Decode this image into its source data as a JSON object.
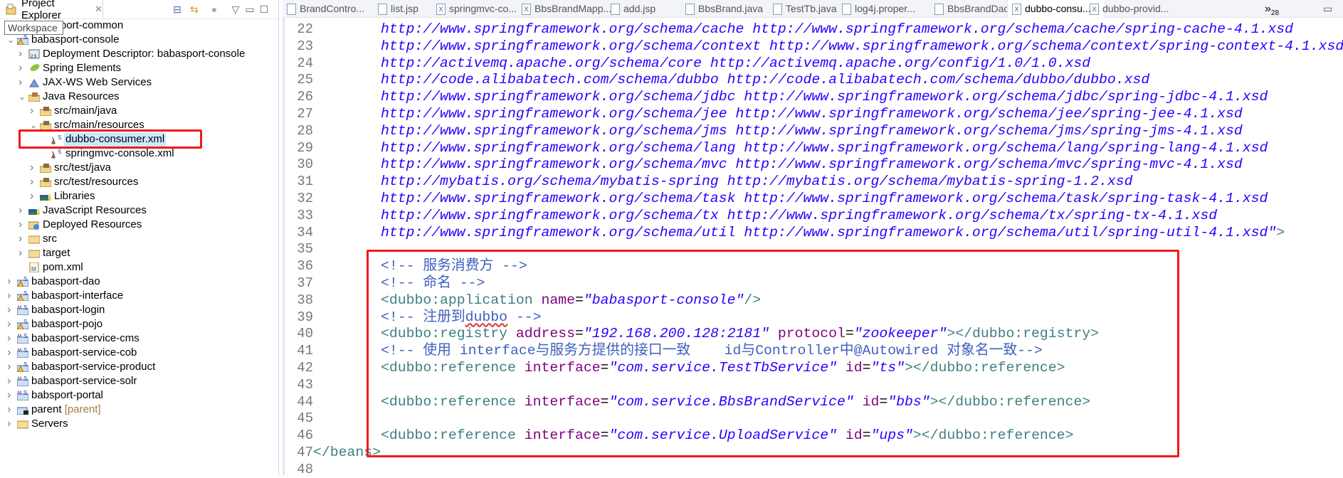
{
  "project_explorer": {
    "title": "Project Explorer",
    "tooltip": "Workspace",
    "tree": [
      {
        "label": "babasport-common",
        "level": 0,
        "expanded": false,
        "icon": "maven-project-icon"
      },
      {
        "label": "babasport-console",
        "level": 0,
        "expanded": true,
        "icon": "maven-project-warning-icon"
      },
      {
        "label": "Deployment Descriptor: babasport-console",
        "level": 1,
        "expanded": false,
        "icon": "deployment-descriptor-icon"
      },
      {
        "label": "Spring Elements",
        "level": 1,
        "expanded": false,
        "icon": "spring-leaf-icon"
      },
      {
        "label": "JAX-WS Web Services",
        "level": 1,
        "expanded": false,
        "icon": "web-services-icon"
      },
      {
        "label": "Java Resources",
        "level": 1,
        "expanded": true,
        "icon": "java-resources-icon"
      },
      {
        "label": "src/main/java",
        "level": 2,
        "expanded": false,
        "icon": "source-folder-icon"
      },
      {
        "label": "src/main/resources",
        "level": 2,
        "expanded": true,
        "icon": "source-folder-icon"
      },
      {
        "label": "dubbo-consumer.xml",
        "level": 3,
        "leaf": true,
        "selected": true,
        "icon": "spring-xml-file-icon"
      },
      {
        "label": "springmvc-console.xml",
        "level": 3,
        "leaf": true,
        "icon": "spring-xml-file-icon"
      },
      {
        "label": "src/test/java",
        "level": 2,
        "expanded": false,
        "icon": "source-folder-icon"
      },
      {
        "label": "src/test/resources",
        "level": 2,
        "expanded": false,
        "icon": "source-folder-icon"
      },
      {
        "label": "Libraries",
        "level": 2,
        "expanded": false,
        "icon": "libraries-icon"
      },
      {
        "label": "JavaScript Resources",
        "level": 1,
        "expanded": false,
        "icon": "libraries-icon"
      },
      {
        "label": "Deployed Resources",
        "level": 1,
        "expanded": false,
        "icon": "deployed-resources-icon"
      },
      {
        "label": "src",
        "level": 1,
        "expanded": false,
        "icon": "folder-icon"
      },
      {
        "label": "target",
        "level": 1,
        "expanded": false,
        "icon": "folder-icon"
      },
      {
        "label": "pom.xml",
        "level": 1,
        "leaf": true,
        "icon": "maven-pom-icon"
      },
      {
        "label": "babasport-dao",
        "level": 0,
        "expanded": false,
        "icon": "maven-project-warning-icon"
      },
      {
        "label": "babasport-interface",
        "level": 0,
        "expanded": false,
        "icon": "maven-project-warning-icon"
      },
      {
        "label": "babasport-login",
        "level": 0,
        "expanded": false,
        "icon": "maven-project-icon"
      },
      {
        "label": "babasport-pojo",
        "level": 0,
        "expanded": false,
        "icon": "maven-project-warning-icon"
      },
      {
        "label": "babasport-service-cms",
        "level": 0,
        "expanded": false,
        "icon": "maven-project-icon"
      },
      {
        "label": "babasport-service-cob",
        "level": 0,
        "expanded": false,
        "icon": "maven-project-icon"
      },
      {
        "label": "babasport-service-product",
        "level": 0,
        "expanded": false,
        "icon": "maven-project-warning-icon"
      },
      {
        "label": "babasport-service-solr",
        "level": 0,
        "expanded": false,
        "icon": "maven-project-icon"
      },
      {
        "label": "babsport-portal",
        "level": 0,
        "expanded": false,
        "icon": "maven-project-icon"
      },
      {
        "label": "parent",
        "decoration": "[parent]",
        "level": 0,
        "expanded": false,
        "icon": "maven-parent-icon"
      },
      {
        "label": "Servers",
        "level": 0,
        "expanded": false,
        "icon": "folder-icon"
      }
    ]
  },
  "editor_tabs": [
    {
      "label": "BrandContro...",
      "active": false
    },
    {
      "label": "list.jsp",
      "active": false
    },
    {
      "label": "springmvc-co...",
      "active": false
    },
    {
      "label": "BbsBrandMapp...",
      "active": false
    },
    {
      "label": "add.jsp",
      "active": false
    },
    {
      "label": "BbsBrand.java",
      "active": false
    },
    {
      "label": "TestTb.java",
      "active": false
    },
    {
      "label": "log4j.proper...",
      "active": false
    },
    {
      "label": "BbsBrandDao...",
      "active": false
    },
    {
      "label": "dubbo-consu...",
      "active": true
    },
    {
      "label": "dubbo-provid...",
      "active": false
    }
  ],
  "overflow_tabs": {
    "label": "»",
    "count": "28"
  },
  "colors": {
    "tag": "#3f7f7f",
    "attribute": "#7f007f",
    "value": "#2a00ff",
    "comment": "#3f5fbf",
    "highlight": "#f01a1a"
  },
  "code_lines": [
    {
      "n": "22",
      "tokens": [
        [
          "v",
          "        http://www.springframework.org/schema/cache http://www.springframework.org/schema/cache/spring-cache-4.1.xsd"
        ]
      ]
    },
    {
      "n": "23",
      "tokens": [
        [
          "v",
          "        http://www.springframework.org/schema/context http://www.springframework.org/schema/context/spring-context-4.1.xsd"
        ]
      ]
    },
    {
      "n": "24",
      "tokens": [
        [
          "v",
          "        http://activemq.apache.org/schema/core http://activemq.apache.org/config/1.0/1.0.xsd"
        ]
      ]
    },
    {
      "n": "25",
      "tokens": [
        [
          "v",
          "        http://code.alibabatech.com/schema/dubbo http://code.alibabatech.com/schema/dubbo/dubbo.xsd"
        ]
      ]
    },
    {
      "n": "26",
      "tokens": [
        [
          "v",
          "        http://www.springframework.org/schema/jdbc http://www.springframework.org/schema/jdbc/spring-jdbc-4.1.xsd"
        ]
      ]
    },
    {
      "n": "27",
      "tokens": [
        [
          "v",
          "        http://www.springframework.org/schema/jee http://www.springframework.org/schema/jee/spring-jee-4.1.xsd"
        ]
      ]
    },
    {
      "n": "28",
      "tokens": [
        [
          "v",
          "        http://www.springframework.org/schema/jms http://www.springframework.org/schema/jms/spring-jms-4.1.xsd"
        ]
      ]
    },
    {
      "n": "29",
      "tokens": [
        [
          "v",
          "        http://www.springframework.org/schema/lang http://www.springframework.org/schema/lang/spring-lang-4.1.xsd"
        ]
      ]
    },
    {
      "n": "30",
      "tokens": [
        [
          "v",
          "        http://www.springframework.org/schema/mvc http://www.springframework.org/schema/mvc/spring-mvc-4.1.xsd"
        ]
      ]
    },
    {
      "n": "31",
      "tokens": [
        [
          "v",
          "        http://mybatis.org/schema/mybatis-spring http://mybatis.org/schema/mybatis-spring-1.2.xsd"
        ]
      ]
    },
    {
      "n": "32",
      "tokens": [
        [
          "v",
          "        http://www.springframework.org/schema/task http://www.springframework.org/schema/task/spring-task-4.1.xsd"
        ]
      ]
    },
    {
      "n": "33",
      "tokens": [
        [
          "v",
          "        http://www.springframework.org/schema/tx http://www.springframework.org/schema/tx/spring-tx-4.1.xsd"
        ]
      ]
    },
    {
      "n": "34",
      "tokens": [
        [
          "v",
          "        http://www.springframework.org/schema/util http://www.springframework.org/schema/util/spring-util-4.1.xsd\""
        ],
        [
          "t",
          ">"
        ]
      ]
    },
    {
      "n": "35",
      "tokens": []
    },
    {
      "n": "36",
      "tokens": [
        [
          "c",
          "        <!-- 服务消费方 -->"
        ]
      ]
    },
    {
      "n": "37",
      "tokens": [
        [
          "c",
          "        <!-- 命名 -->"
        ]
      ]
    },
    {
      "n": "38",
      "tokens": [
        [
          "t",
          "        <dubbo:application "
        ],
        [
          "a",
          "name"
        ],
        [
          "e",
          "="
        ],
        [
          "v",
          "\"babasport-console\""
        ],
        [
          "t",
          "/>"
        ]
      ]
    },
    {
      "n": "39",
      "tokens": [
        [
          "c",
          "        <!-- 注册到"
        ],
        [
          "c sq",
          "dubbo"
        ],
        [
          "c",
          " -->"
        ]
      ]
    },
    {
      "n": "40",
      "tokens": [
        [
          "t",
          "        <dubbo:registry "
        ],
        [
          "a",
          "address"
        ],
        [
          "e",
          "="
        ],
        [
          "v",
          "\"192.168.200.128:2181\" "
        ],
        [
          "a",
          "protocol"
        ],
        [
          "e",
          "="
        ],
        [
          "v",
          "\"zookeeper\""
        ],
        [
          "t",
          "></dubbo:registry>"
        ]
      ]
    },
    {
      "n": "41",
      "tokens": [
        [
          "c",
          "        <!-- 使用 interface与服务方提供的接口一致    id与Controller中@Autowired 对象名一致-->"
        ]
      ]
    },
    {
      "n": "42",
      "tokens": [
        [
          "t",
          "        <dubbo:reference "
        ],
        [
          "a",
          "interface"
        ],
        [
          "e",
          "="
        ],
        [
          "v",
          "\"com.service.TestTbService\" "
        ],
        [
          "a",
          "id"
        ],
        [
          "e",
          "="
        ],
        [
          "v",
          "\"ts\""
        ],
        [
          "t",
          "></dubbo:reference>"
        ]
      ]
    },
    {
      "n": "43",
      "tokens": []
    },
    {
      "n": "44",
      "tokens": [
        [
          "t",
          "        <dubbo:reference "
        ],
        [
          "a",
          "interface"
        ],
        [
          "e",
          "="
        ],
        [
          "v",
          "\"com.service.BbsBrandService\" "
        ],
        [
          "a",
          "id"
        ],
        [
          "e",
          "="
        ],
        [
          "v",
          "\"bbs\""
        ],
        [
          "t",
          "></dubbo:reference>"
        ]
      ]
    },
    {
      "n": "45",
      "tokens": []
    },
    {
      "n": "46",
      "tokens": [
        [
          "t",
          "        <dubbo:reference "
        ],
        [
          "a",
          "interface"
        ],
        [
          "e",
          "="
        ],
        [
          "v",
          "\"com.service.UploadService\" "
        ],
        [
          "a",
          "id"
        ],
        [
          "e",
          "="
        ],
        [
          "v",
          "\"ups\""
        ],
        [
          "t",
          "></dubbo:reference>"
        ]
      ]
    },
    {
      "n": "47",
      "tokens": [
        [
          "t",
          "</beans>"
        ]
      ]
    },
    {
      "n": "48",
      "tokens": []
    }
  ]
}
